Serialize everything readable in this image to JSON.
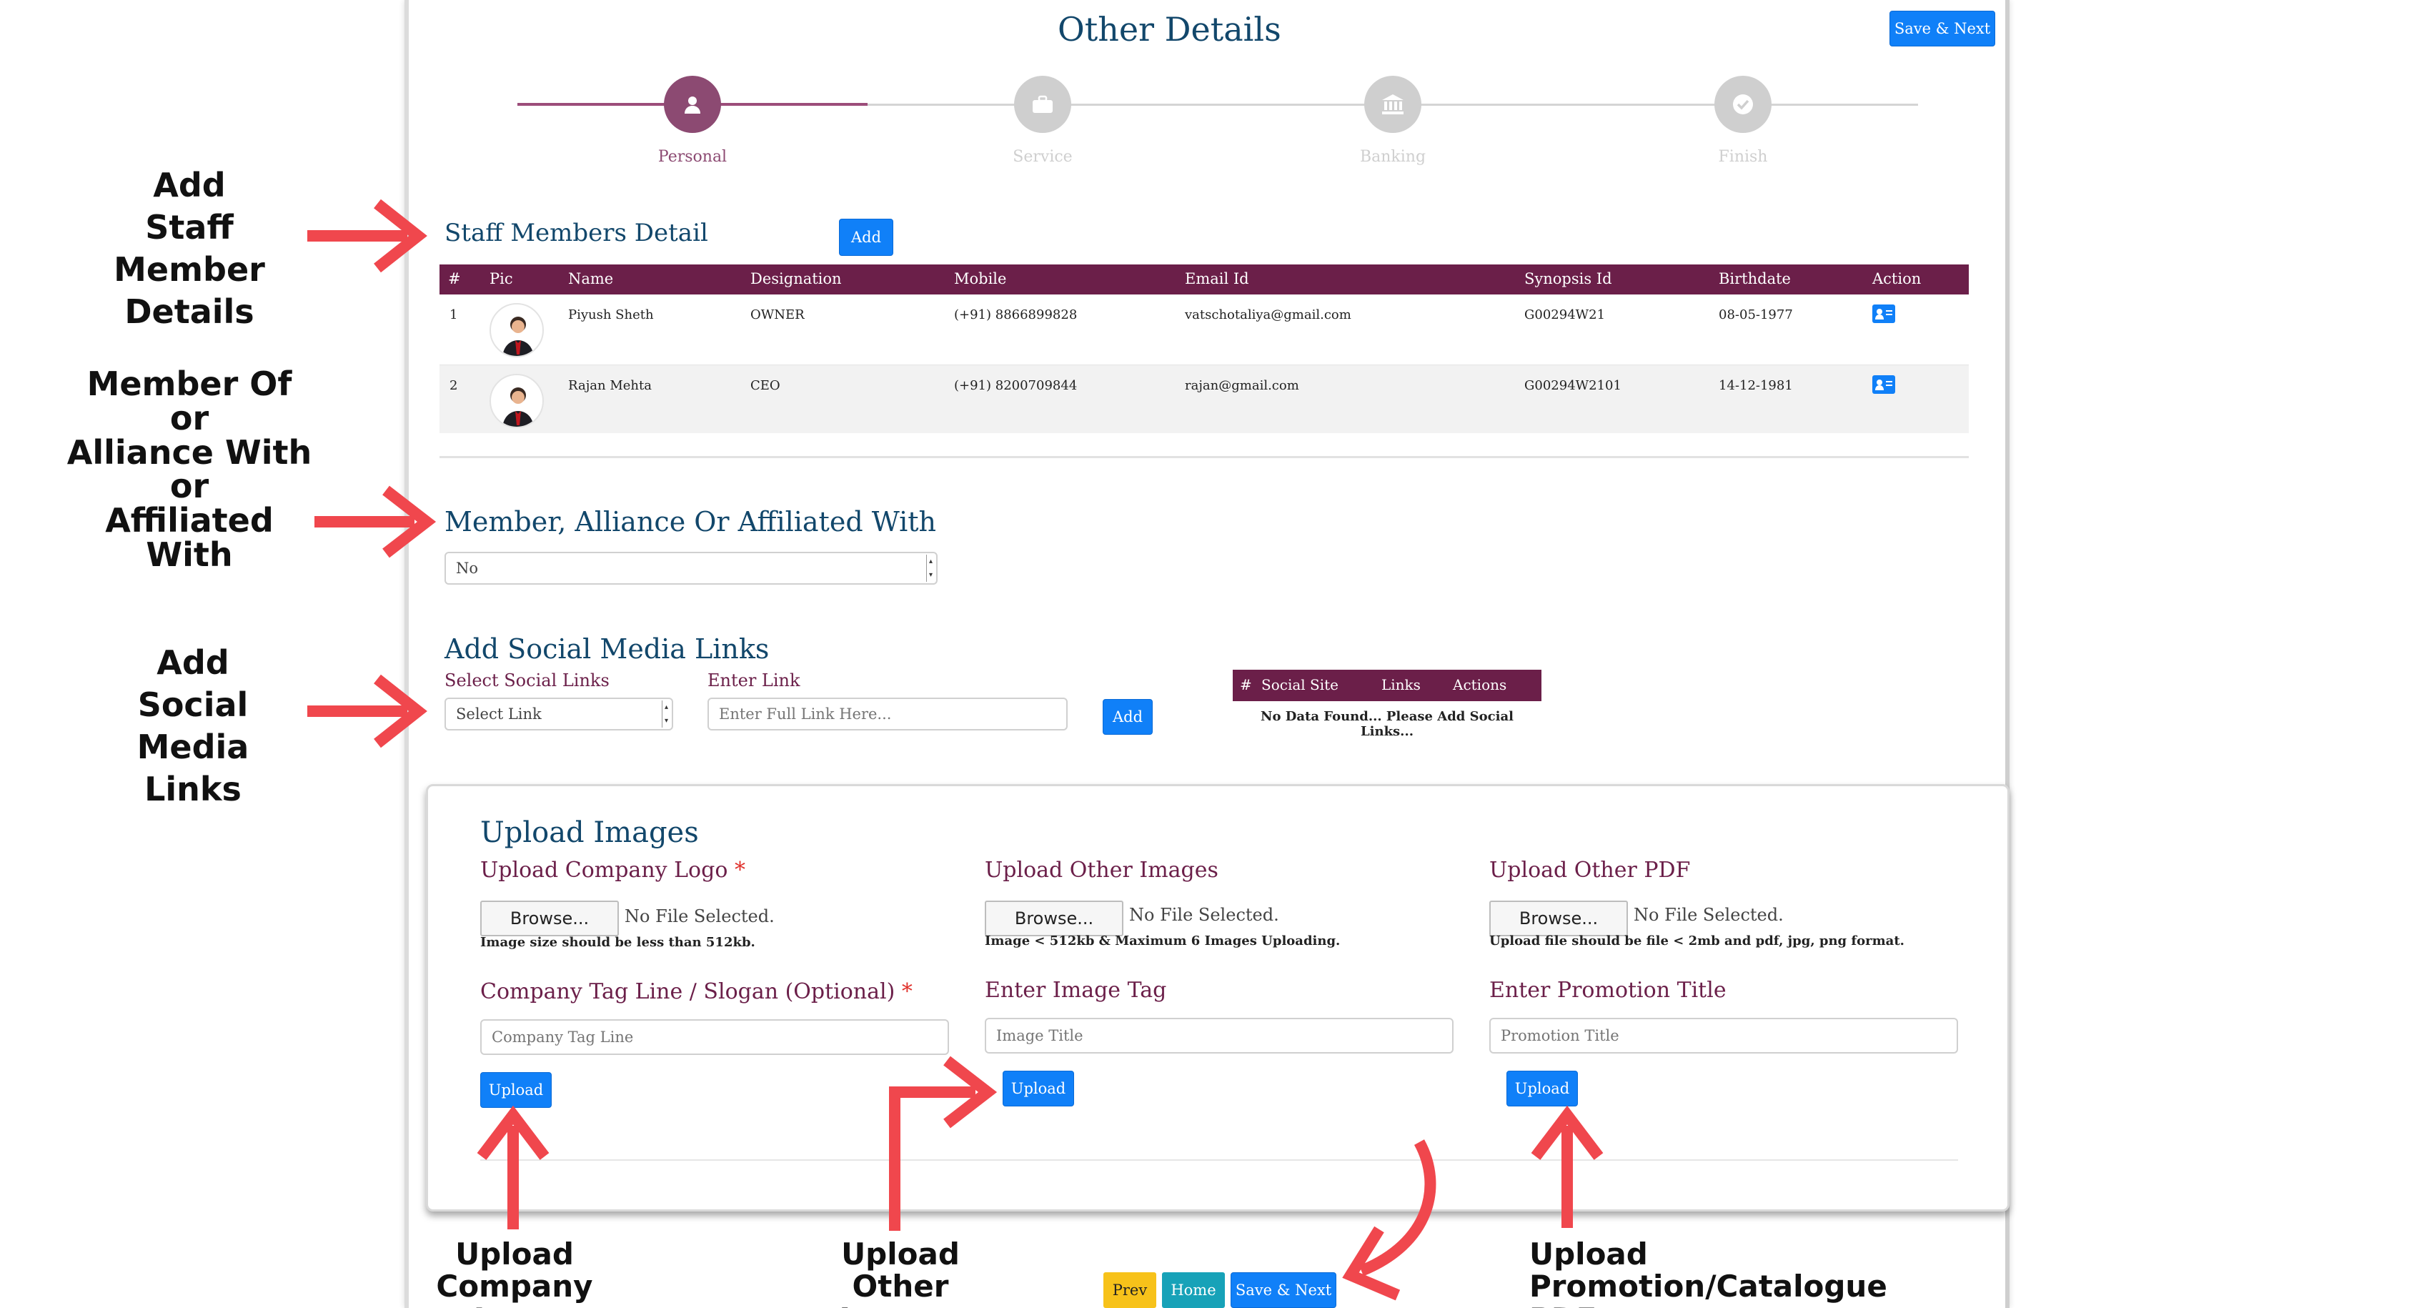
{
  "header": {
    "title": "Other Details",
    "save_next_label": "Save & Next"
  },
  "steps": [
    {
      "label": "Personal",
      "active": true,
      "icon": "user-icon"
    },
    {
      "label": "Service",
      "active": false,
      "icon": "briefcase-icon"
    },
    {
      "label": "Banking",
      "active": false,
      "icon": "bank-icon"
    },
    {
      "label": "Finish",
      "active": false,
      "icon": "check-icon"
    }
  ],
  "staff": {
    "title": "Staff Members Detail",
    "add_label": "Add",
    "columns": [
      "#",
      "Pic",
      "Name",
      "Designation",
      "Mobile",
      "Email Id",
      "Synopsis Id",
      "Birthdate",
      "Action"
    ],
    "rows": [
      {
        "num": "1",
        "name": "Piyush Sheth",
        "designation": "OWNER",
        "mobile": "(+91) 8866899828",
        "email": "vatschotaliya@gmail.com",
        "synopsis": "G00294W21",
        "birthdate": "08-05-1977"
      },
      {
        "num": "2",
        "name": "Rajan Mehta",
        "designation": "CEO",
        "mobile": "(+91) 8200709844",
        "email": "rajan@gmail.com",
        "synopsis": "G00294W2101",
        "birthdate": "14-12-1981"
      }
    ]
  },
  "membership": {
    "title": "Member, Alliance Or Affiliated With",
    "selected": "No"
  },
  "social": {
    "title": "Add Social Media Links",
    "select_label": "Select Social Links",
    "select_value": "Select Link",
    "link_label": "Enter Link",
    "link_placeholder": "Enter Full Link Here...",
    "add_label": "Add",
    "table_columns": [
      "#",
      "Social Site",
      "Links",
      "Actions"
    ],
    "empty_text": "No Data Found... Please Add Social Links..."
  },
  "upload": {
    "title": "Upload Images",
    "logo": {
      "label": "Upload Company Logo",
      "required": "*",
      "browse": "Browse...",
      "nofile": "No File Selected.",
      "hint": "Image size should be less than 512kb.",
      "tag_label": "Company Tag Line / Slogan (Optional)",
      "tag_placeholder": "Company Tag Line",
      "upload": "Upload"
    },
    "other_images": {
      "label": "Upload Other Images",
      "browse": "Browse...",
      "nofile": "No File Selected.",
      "hint": "Image < 512kb & Maximum 6 Images Uploading.",
      "tag_label": "Enter Image Tag",
      "tag_placeholder": "Image Title",
      "upload": "Upload"
    },
    "pdf": {
      "label": "Upload Other PDF",
      "browse": "Browse...",
      "nofile": "No File Selected.",
      "hint": "Upload file should be file < 2mb and pdf, jpg, png format.",
      "tag_label": "Enter Promotion Title",
      "tag_placeholder": "Promotion Title",
      "upload": "Upload"
    }
  },
  "footer": {
    "prev": "Prev",
    "home": "Home",
    "save_next": "Save & Next"
  },
  "annotations": {
    "staff": [
      "Add",
      "Staff Member",
      "Details"
    ],
    "member": [
      "Member Of",
      "or",
      "Alliance With",
      "or",
      "Affiliated With"
    ],
    "social": [
      "Add",
      "Social Media",
      "Links"
    ],
    "logo": [
      "Upload",
      "Company Logo"
    ],
    "other": [
      "Upload",
      "Other Images"
    ],
    "pdf": [
      "Upload",
      "Promotion/Catalogue PDF"
    ]
  },
  "colors": {
    "accent": "#6b1f49",
    "title": "#12476b",
    "button": "#1080f8",
    "arrow": "#f0474d",
    "prev": "#f7c21a",
    "home": "#17a2b8"
  }
}
